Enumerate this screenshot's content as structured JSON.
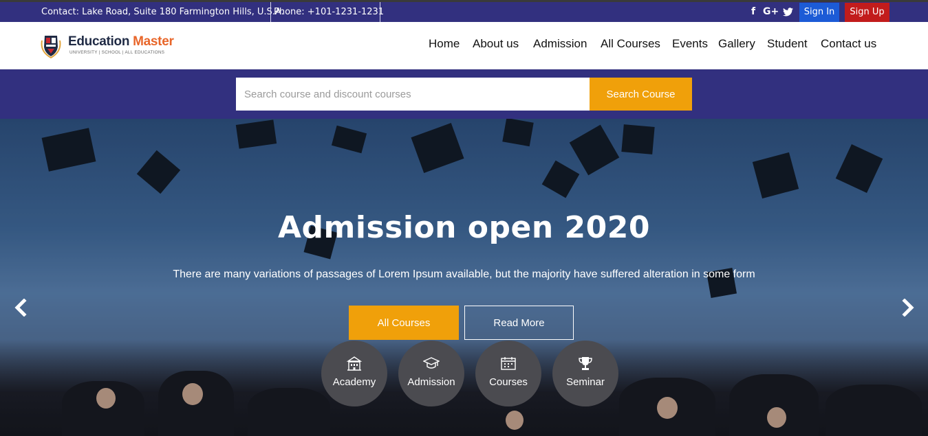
{
  "topbar": {
    "contact": "Contact: Lake Road, Suite 180 Farmington Hills, U.S.A.",
    "phone": "Phone: +101-1231-1231",
    "social_icons": [
      "facebook-icon",
      "google-plus-icon",
      "twitter-icon"
    ],
    "social": {
      "facebook": "f",
      "google_plus": "G+",
      "twitter": "🐦"
    },
    "signin_label": "Sign In",
    "signup_label": "Sign Up",
    "signin_color": "#1c5bd6",
    "signup_color": "#c21c1c"
  },
  "brand": {
    "name_part1": "Education",
    "name_part2": "Master",
    "tagline": "UNIVERSITY | SCHOOL | ALL EDUCATIONS",
    "accent_color": "#e8662a"
  },
  "nav": {
    "items": [
      "Home",
      "About us",
      "Admission",
      "All Courses",
      "Events",
      "Gallery",
      "Student",
      "Contact us"
    ]
  },
  "search": {
    "placeholder": "Search course and discount courses",
    "value": "",
    "button_label": "Search Course",
    "band_color": "#32307f",
    "button_color": "#f0a00a"
  },
  "hero": {
    "title": "Admission open 2020",
    "subtitle": "There are many variations of passages of Lorem Ipsum available, but the majority have suffered alteration in some form",
    "primary_button": "All Courses",
    "secondary_button": "Read More",
    "prev_arrow": "‹",
    "next_arrow": "›",
    "prev_icon": "chevron-left-icon",
    "next_icon": "chevron-right-icon",
    "quick_links": [
      {
        "label": "Academy",
        "icon": "building-icon"
      },
      {
        "label": "Admission",
        "icon": "graduation-cap-icon"
      },
      {
        "label": "Courses",
        "icon": "calendar-icon"
      },
      {
        "label": "Seminar",
        "icon": "trophy-icon"
      }
    ]
  }
}
